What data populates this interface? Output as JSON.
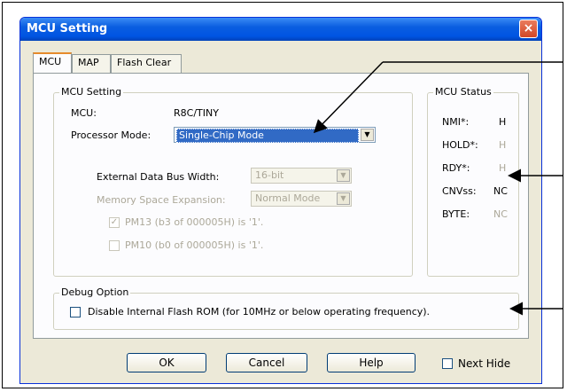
{
  "dialog": {
    "title": "MCU Setting",
    "close_label": "×"
  },
  "tabs": [
    {
      "label": "MCU"
    },
    {
      "label": "MAP"
    },
    {
      "label": "Flash Clear"
    }
  ],
  "mcu_setting": {
    "legend": "MCU Setting",
    "mcu_label": "MCU:",
    "mcu_value": "R8C/TINY",
    "processor_mode_label": "Processor Mode:",
    "processor_mode_value": "Single-Chip Mode",
    "ext_bus_label": "External Data Bus Width:",
    "ext_bus_value": "16-bit",
    "mem_exp_label": "Memory Space Expansion:",
    "mem_exp_value": "Normal Mode",
    "pm13_label": "PM13 (b3 of 000005H) is '1'.",
    "pm10_label": "PM10 (b0 of 000005H) is '1'."
  },
  "mcu_status": {
    "legend": "MCU Status",
    "rows": [
      {
        "label": "NMI*:",
        "value": "H"
      },
      {
        "label": "HOLD*:",
        "value": "H"
      },
      {
        "label": "RDY*:",
        "value": "H"
      },
      {
        "label": "CNVss:",
        "value": "NC"
      },
      {
        "label": "BYTE:",
        "value": "NC"
      }
    ]
  },
  "debug_option": {
    "legend": "Debug Option",
    "disable_flash_label": "Disable Internal Flash ROM (for 10MHz or below operating frequency)."
  },
  "buttons": {
    "ok": "OK",
    "cancel": "Cancel",
    "help": "Help",
    "next_hide": "Next Hide"
  }
}
